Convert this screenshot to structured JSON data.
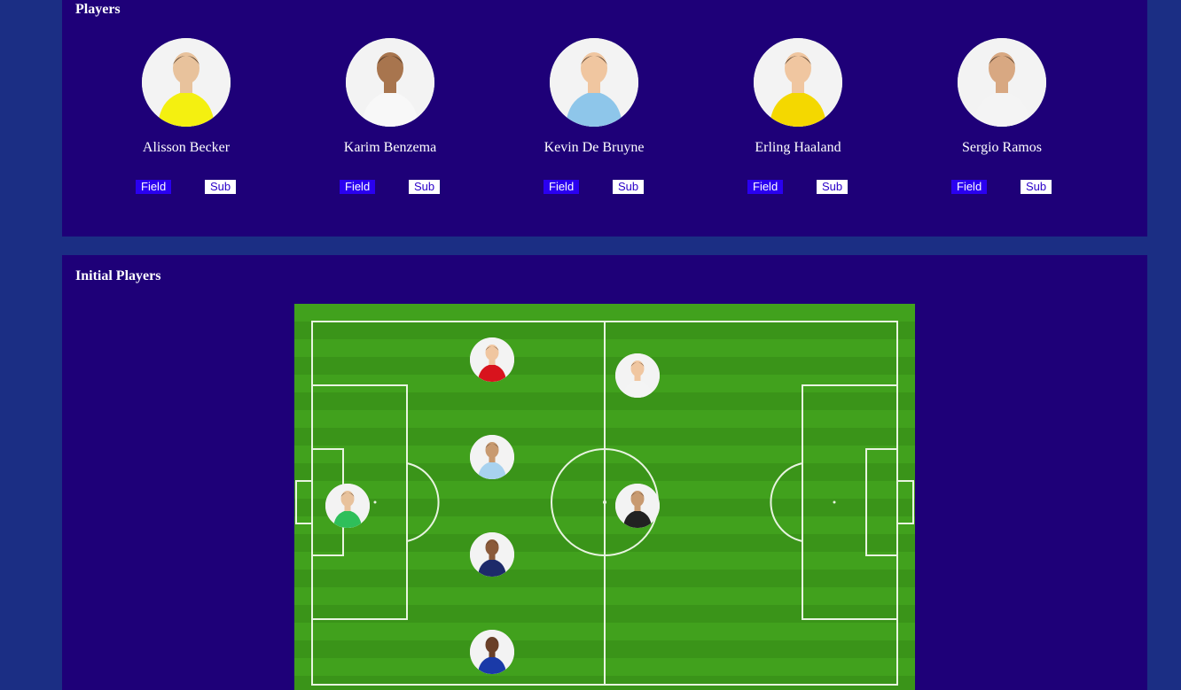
{
  "players_section": {
    "title": "Players",
    "field_label": "Field",
    "sub_label": "Sub",
    "players": [
      {
        "name": "Alisson Becker",
        "kit": "#f4f010",
        "skin": "#e8c29c"
      },
      {
        "name": "Karim Benzema",
        "kit": "#f8f8f8",
        "skin": "#a8754e"
      },
      {
        "name": "Kevin De Bruyne",
        "kit": "#8ec6ea",
        "skin": "#f0c6a0"
      },
      {
        "name": "Erling Haaland",
        "kit": "#f4d800",
        "skin": "#f0c6a0"
      },
      {
        "name": "Sergio Ramos",
        "kit": "#f4f4f4",
        "skin": "#d8a882"
      },
      {
        "name": "Sergio",
        "kit": "#f4f4f4",
        "skin": "#d8a882"
      }
    ]
  },
  "initial_section": {
    "title": "Initial Players",
    "pitch_color": "#3f9a1c",
    "tokens": [
      {
        "name": "goalkeeper-token",
        "kit": "#2fbf5a",
        "skin": "#e8c29c"
      },
      {
        "name": "defender-token-1",
        "kit": "#d8131d",
        "skin": "#f0c6a0"
      },
      {
        "name": "defender-token-2",
        "kit": "#a8d2ef",
        "skin": "#c89a70"
      },
      {
        "name": "defender-token-3",
        "kit": "#1d2a6a",
        "skin": "#8a5a3a"
      },
      {
        "name": "defender-token-4",
        "kit": "#1a3aa8",
        "skin": "#6a4028"
      },
      {
        "name": "forward-token-1",
        "kit": "#f4f4f4",
        "skin": "#f0c6a0"
      },
      {
        "name": "forward-token-2",
        "kit": "#222222",
        "skin": "#c89a70"
      }
    ]
  }
}
